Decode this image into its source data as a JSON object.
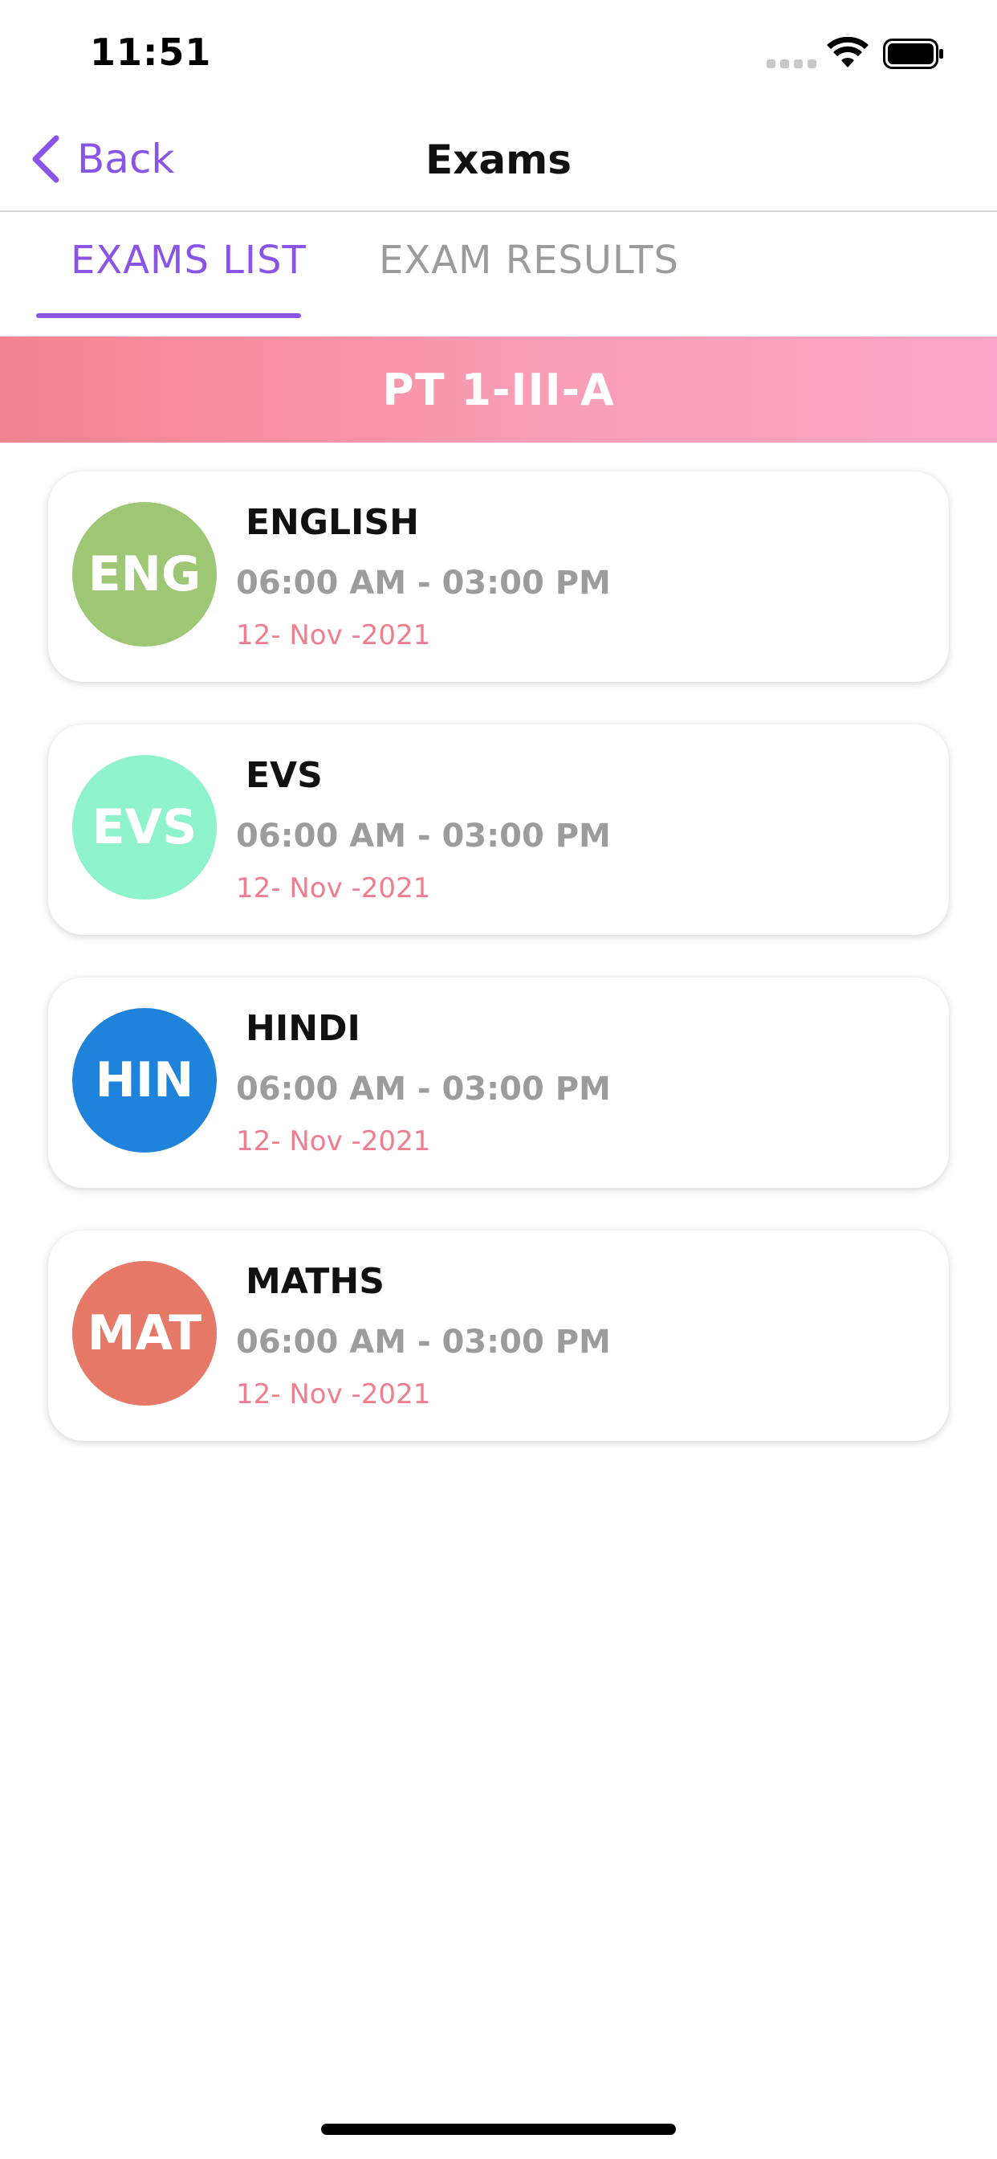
{
  "status_bar": {
    "time": "11:51"
  },
  "nav": {
    "back_label": "Back",
    "title": "Exams"
  },
  "tabs": [
    {
      "label": "EXAMS LIST",
      "active": true
    },
    {
      "label": "EXAM RESULTS",
      "active": false
    }
  ],
  "section": {
    "title": "PT 1-III-A"
  },
  "exams": [
    {
      "abbr": "ENG",
      "subject": "ENGLISH",
      "time": "06:00 AM - 03:00 PM",
      "date": "12- Nov -2021",
      "color": "#9dc675"
    },
    {
      "abbr": "EVS",
      "subject": "EVS",
      "time": "06:00 AM - 03:00 PM",
      "date": "12- Nov -2021",
      "color": "#8ef3ca"
    },
    {
      "abbr": "HIN",
      "subject": "HINDI",
      "time": "06:00 AM - 03:00 PM",
      "date": "12- Nov -2021",
      "color": "#1f82db"
    },
    {
      "abbr": "MAT",
      "subject": "MATHS",
      "time": "06:00 AM - 03:00 PM",
      "date": "12- Nov -2021",
      "color": "#e57866"
    }
  ],
  "colors": {
    "accent": "#8a55e6",
    "inactive_tab": "#9b9b9b",
    "date_text": "#ef7e8f",
    "banner_start": "#f4838f",
    "banner_end": "#fca5c6"
  },
  "icons": {
    "back": "chevron-left-icon",
    "wifi": "wifi-icon",
    "battery": "battery-icon",
    "signal": "cellular-signal-icon"
  }
}
